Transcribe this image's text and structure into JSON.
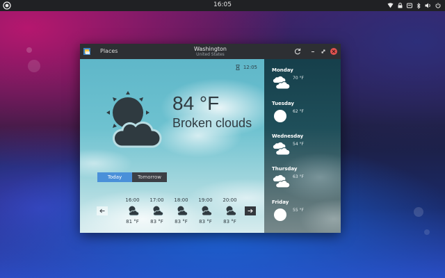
{
  "topbar": {
    "clock": "16:05",
    "tray_icons": [
      "wifi-icon",
      "lock-icon",
      "notification-icon",
      "bluetooth-icon",
      "volume-icon",
      "power-icon"
    ]
  },
  "window": {
    "app_icon": "weather-app-icon",
    "places_label": "Places",
    "title": "Washington",
    "subtitle": "United States"
  },
  "current": {
    "time": "12:05",
    "temperature": "84 °F",
    "condition": "Broken clouds",
    "icon": "sun-cloud-icon"
  },
  "tabs": [
    {
      "label": "Today",
      "active": true
    },
    {
      "label": "Tomorrow",
      "active": false
    }
  ],
  "hourly": [
    {
      "time": "16:00",
      "temp": "81 °F",
      "icon": "sun-cloud-icon"
    },
    {
      "time": "17:00",
      "temp": "83 °F",
      "icon": "sun-cloud-icon"
    },
    {
      "time": "18:00",
      "temp": "83 °F",
      "icon": "sun-cloud-icon"
    },
    {
      "time": "19:00",
      "temp": "83 °F",
      "icon": "sun-cloud-icon"
    },
    {
      "time": "20:00",
      "temp": "83 °F",
      "icon": "sun-cloud-icon"
    }
  ],
  "forecast": [
    {
      "day": "Monday",
      "temp": "70 °F",
      "icon": "clouds-icon"
    },
    {
      "day": "Tuesday",
      "temp": "62 °F",
      "icon": "sun-icon"
    },
    {
      "day": "Wednesday",
      "temp": "54 °F",
      "icon": "clouds-icon"
    },
    {
      "day": "Thursday",
      "temp": "63 °F",
      "icon": "clouds-icon"
    },
    {
      "day": "Friday",
      "temp": "55 °F",
      "icon": "sun-icon"
    }
  ],
  "colors": {
    "accent": "#4a90d9",
    "close": "#e0524f",
    "header": "#2d2f33"
  }
}
